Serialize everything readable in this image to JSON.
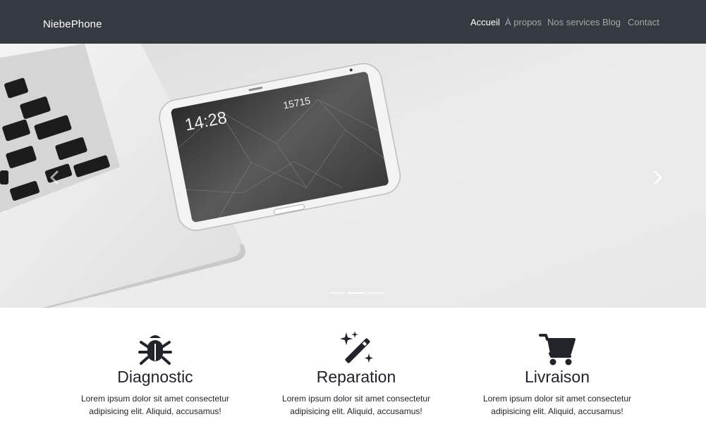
{
  "navbar": {
    "brand": "NiebePhone",
    "links": [
      {
        "label": "Accueil",
        "active": true
      },
      {
        "label": "À propos",
        "active": false
      },
      {
        "label": "Nos services",
        "active": false
      },
      {
        "label": "Blog",
        "active": false
      },
      {
        "label": "Contact",
        "active": false
      }
    ]
  },
  "carousel": {
    "controls": {
      "prev_icon": "chevron-left-icon",
      "next_icon": "chevron-right-icon"
    },
    "slide_count": 3,
    "active_slide": 2,
    "phone_screen": {
      "time": "14:28",
      "steps": "15715"
    }
  },
  "features": [
    {
      "icon": "bug-icon",
      "title": "Diagnostic",
      "text_line1": "Lorem ipsum dolor sit amet consectetur",
      "text_line2": "adipisicing elit. Aliquid, accusamus!"
    },
    {
      "icon": "magic-wand-icon",
      "title": "Reparation",
      "text_line1": "Lorem ipsum dolor sit amet consectetur",
      "text_line2": "adipisicing elit. Aliquid, accusamus!"
    },
    {
      "icon": "shopping-cart-icon",
      "title": "Livraison",
      "text_line1": "Lorem ipsum dolor sit amet consectetur",
      "text_line2": "adipisicing elit. Aliquid, accusamus!"
    }
  ],
  "colors": {
    "navbar_bg": "#343a40",
    "nav_active": "#ffffff",
    "nav_inactive": "rgba(255,255,255,0.55)",
    "text": "#212529"
  }
}
